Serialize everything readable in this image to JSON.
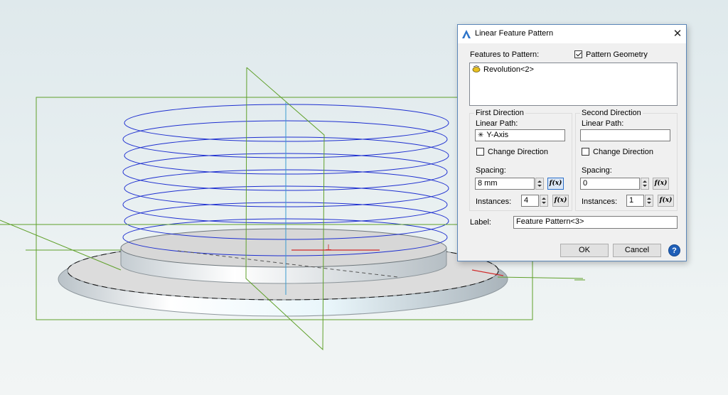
{
  "dialog": {
    "title": "Linear Feature Pattern",
    "close_glyph": "✕",
    "features_label": "Features to Pattern:",
    "pattern_geometry_label": "Pattern Geometry",
    "pattern_geometry_checked": true,
    "features": [
      {
        "name": "Revolution<2>",
        "icon": "revolution-feature-icon"
      }
    ],
    "first_direction": {
      "title": "First Direction",
      "linear_path_label": "Linear Path:",
      "linear_path_value": "Y-Axis",
      "linear_path_icon": "axis-icon",
      "change_direction_label": "Change Direction",
      "change_direction_checked": false,
      "spacing_label": "Spacing:",
      "spacing_value": "8 mm",
      "instances_label": "Instances:",
      "instances_value": "4",
      "fx_label": "f(x)"
    },
    "second_direction": {
      "title": "Second Direction",
      "linear_path_label": "Linear Path:",
      "linear_path_value": "",
      "change_direction_label": "Change Direction",
      "change_direction_checked": false,
      "spacing_label": "Spacing:",
      "spacing_value": "0",
      "instances_label": "Instances:",
      "instances_value": "1",
      "fx_label": "f(x)"
    },
    "label_label": "Label:",
    "label_value": "Feature Pattern<3>",
    "ok_label": "OK",
    "cancel_label": "Cancel",
    "help_glyph": "?"
  },
  "colors": {
    "helix": "#1e2fd0",
    "plane_outline": "#5fa02a",
    "dialog_border": "#5b86b8",
    "accent": "#1f5fb8"
  }
}
